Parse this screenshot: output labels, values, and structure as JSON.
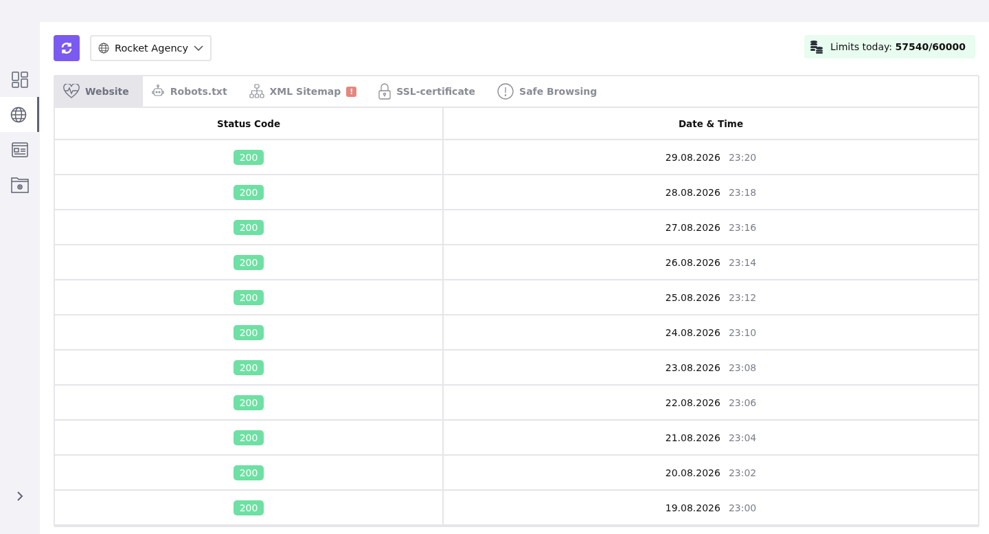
{
  "sidebar": {
    "items": [
      {
        "kind": "dashboard",
        "selected": false
      },
      {
        "kind": "globe",
        "selected": true
      },
      {
        "kind": "card",
        "selected": false
      },
      {
        "kind": "folder",
        "selected": false
      }
    ]
  },
  "toolbar": {
    "project": "Rocket Agency",
    "limits_label": "Limits today:",
    "limits_value": "57540/60000"
  },
  "tabs": [
    {
      "label": "Website",
      "kind": "heart",
      "selected": true,
      "alert": false
    },
    {
      "label": "Robots.txt",
      "kind": "robot",
      "selected": false,
      "alert": false
    },
    {
      "label": "XML Sitemap",
      "kind": "tree",
      "selected": false,
      "alert": true,
      "alert_text": "!"
    },
    {
      "label": "SSL-certificate",
      "kind": "lock",
      "selected": false,
      "alert": false
    },
    {
      "label": "Safe Browsing",
      "kind": "info",
      "selected": false,
      "alert": false
    }
  ],
  "table": {
    "columns": [
      "Status Code",
      "Date & Time"
    ],
    "rows": [
      {
        "status": "200",
        "date": "29.08.2026",
        "time": "23:20"
      },
      {
        "status": "200",
        "date": "28.08.2026",
        "time": "23:18"
      },
      {
        "status": "200",
        "date": "27.08.2026",
        "time": "23:16"
      },
      {
        "status": "200",
        "date": "26.08.2026",
        "time": "23:14"
      },
      {
        "status": "200",
        "date": "25.08.2026",
        "time": "23:12"
      },
      {
        "status": "200",
        "date": "24.08.2026",
        "time": "23:10"
      },
      {
        "status": "200",
        "date": "23.08.2026",
        "time": "23:08"
      },
      {
        "status": "200",
        "date": "22.08.2026",
        "time": "23:06"
      },
      {
        "status": "200",
        "date": "21.08.2026",
        "time": "23:04"
      },
      {
        "status": "200",
        "date": "20.08.2026",
        "time": "23:02"
      },
      {
        "status": "200",
        "date": "19.08.2026",
        "time": "23:00"
      }
    ]
  }
}
